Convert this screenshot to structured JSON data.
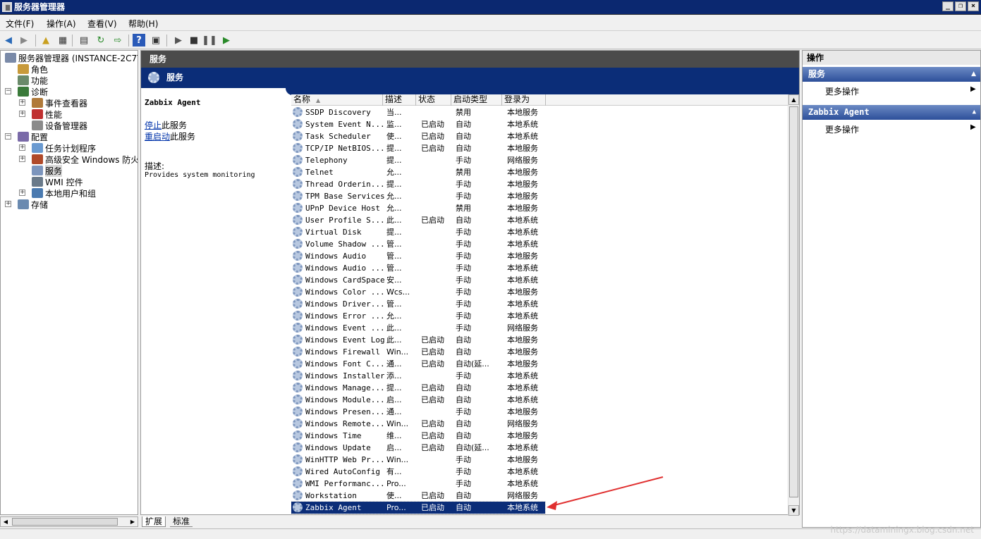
{
  "window": {
    "title": "服务器管理器",
    "buttons": [
      "_",
      "❐",
      "×"
    ]
  },
  "menu": [
    "文件(F)",
    "操作(A)",
    "查看(V)",
    "帮助(H)"
  ],
  "toolbar": [
    "back-icon",
    "forward-icon",
    "up-folder-icon",
    "show-hide-tree-icon",
    "properties-icon",
    "refresh-icon",
    "export-icon",
    "help-icon",
    "view-icon",
    "play-icon",
    "stop-icon",
    "pause-icon",
    "resume-icon"
  ],
  "tree": [
    {
      "label": "服务器管理器 (INSTANCE-2C7T7",
      "level": 0,
      "icon": "server-icon",
      "exp": ""
    },
    {
      "label": "角色",
      "level": 1,
      "icon": "roles-icon",
      "exp": ""
    },
    {
      "label": "功能",
      "level": 1,
      "icon": "features-icon",
      "exp": ""
    },
    {
      "label": "诊断",
      "level": 1,
      "icon": "diagnostics-icon",
      "exp": "-"
    },
    {
      "label": "事件查看器",
      "level": 2,
      "icon": "event-viewer-icon",
      "exp": "+"
    },
    {
      "label": "性能",
      "level": 2,
      "icon": "performance-icon",
      "exp": "+"
    },
    {
      "label": "设备管理器",
      "level": 2,
      "icon": "device-manager-icon",
      "exp": ""
    },
    {
      "label": "配置",
      "level": 1,
      "icon": "configuration-icon",
      "exp": "-"
    },
    {
      "label": "任务计划程序",
      "level": 2,
      "icon": "task-scheduler-icon",
      "exp": "+"
    },
    {
      "label": "高级安全 Windows 防火墙",
      "level": 2,
      "icon": "firewall-icon",
      "exp": "+"
    },
    {
      "label": "服务",
      "level": 2,
      "icon": "services-icon",
      "exp": "",
      "selected": true
    },
    {
      "label": "WMI 控件",
      "level": 2,
      "icon": "wmi-icon",
      "exp": ""
    },
    {
      "label": "本地用户和组",
      "level": 2,
      "icon": "users-groups-icon",
      "exp": "+"
    },
    {
      "label": "存储",
      "level": 1,
      "icon": "storage-icon",
      "exp": "+"
    }
  ],
  "center": {
    "title": "服务",
    "subtitle": "服务",
    "selected_name": "Zabbix Agent",
    "stop_link": "停止",
    "stop_suffix": "此服务",
    "restart_link": "重启动",
    "restart_suffix": "此服务",
    "desc_label": "描述:",
    "desc_text": "Provides system monitoring"
  },
  "columns": [
    "名称",
    "描述",
    "状态",
    "启动类型",
    "登录为"
  ],
  "services": [
    {
      "name": "SSDP Discovery",
      "desc": "当...",
      "status": "",
      "startup": "禁用",
      "logon": "本地服务"
    },
    {
      "name": "System Event N...",
      "desc": "监...",
      "status": "已启动",
      "startup": "自动",
      "logon": "本地系统"
    },
    {
      "name": "Task Scheduler",
      "desc": "使...",
      "status": "已启动",
      "startup": "自动",
      "logon": "本地系统"
    },
    {
      "name": "TCP/IP NetBIOS...",
      "desc": "提...",
      "status": "已启动",
      "startup": "自动",
      "logon": "本地服务"
    },
    {
      "name": "Telephony",
      "desc": "提...",
      "status": "",
      "startup": "手动",
      "logon": "网络服务"
    },
    {
      "name": "Telnet",
      "desc": "允...",
      "status": "",
      "startup": "禁用",
      "logon": "本地服务"
    },
    {
      "name": "Thread Orderin...",
      "desc": "提...",
      "status": "",
      "startup": "手动",
      "logon": "本地服务"
    },
    {
      "name": "TPM Base Services",
      "desc": "允...",
      "status": "",
      "startup": "手动",
      "logon": "本地服务"
    },
    {
      "name": "UPnP Device Host",
      "desc": "允...",
      "status": "",
      "startup": "禁用",
      "logon": "本地服务"
    },
    {
      "name": "User Profile S...",
      "desc": "此...",
      "status": "已启动",
      "startup": "自动",
      "logon": "本地系统"
    },
    {
      "name": "Virtual Disk",
      "desc": "提...",
      "status": "",
      "startup": "手动",
      "logon": "本地系统"
    },
    {
      "name": "Volume Shadow ...",
      "desc": "管...",
      "status": "",
      "startup": "手动",
      "logon": "本地系统"
    },
    {
      "name": "Windows Audio",
      "desc": "管...",
      "status": "",
      "startup": "手动",
      "logon": "本地服务"
    },
    {
      "name": "Windows Audio ...",
      "desc": "管...",
      "status": "",
      "startup": "手动",
      "logon": "本地系统"
    },
    {
      "name": "Windows CardSpace",
      "desc": "安...",
      "status": "",
      "startup": "手动",
      "logon": "本地系统"
    },
    {
      "name": "Windows Color ...",
      "desc": "Wcs...",
      "status": "",
      "startup": "手动",
      "logon": "本地服务"
    },
    {
      "name": "Windows Driver...",
      "desc": "管...",
      "status": "",
      "startup": "手动",
      "logon": "本地系统"
    },
    {
      "name": "Windows Error ...",
      "desc": "允...",
      "status": "",
      "startup": "手动",
      "logon": "本地系统"
    },
    {
      "name": "Windows Event ...",
      "desc": "此...",
      "status": "",
      "startup": "手动",
      "logon": "网络服务"
    },
    {
      "name": "Windows Event Log",
      "desc": "此...",
      "status": "已启动",
      "startup": "自动",
      "logon": "本地服务"
    },
    {
      "name": "Windows Firewall",
      "desc": "Win...",
      "status": "已启动",
      "startup": "自动",
      "logon": "本地服务"
    },
    {
      "name": "Windows Font C...",
      "desc": "通...",
      "status": "已启动",
      "startup": "自动(延...",
      "logon": "本地服务"
    },
    {
      "name": "Windows Installer",
      "desc": "添...",
      "status": "",
      "startup": "手动",
      "logon": "本地系统"
    },
    {
      "name": "Windows Manage...",
      "desc": "提...",
      "status": "已启动",
      "startup": "自动",
      "logon": "本地系统"
    },
    {
      "name": "Windows Module...",
      "desc": "启...",
      "status": "已启动",
      "startup": "自动",
      "logon": "本地系统"
    },
    {
      "name": "Windows Presen...",
      "desc": "通...",
      "status": "",
      "startup": "手动",
      "logon": "本地服务"
    },
    {
      "name": "Windows Remote...",
      "desc": "Win...",
      "status": "已启动",
      "startup": "自动",
      "logon": "网络服务"
    },
    {
      "name": "Windows Time",
      "desc": "维...",
      "status": "已启动",
      "startup": "自动",
      "logon": "本地服务"
    },
    {
      "name": "Windows Update",
      "desc": "启...",
      "status": "已启动",
      "startup": "自动(延...",
      "logon": "本地系统"
    },
    {
      "name": "WinHTTP Web Pr...",
      "desc": "Win...",
      "status": "",
      "startup": "手动",
      "logon": "本地服务"
    },
    {
      "name": "Wired AutoConfig",
      "desc": "有...",
      "status": "",
      "startup": "手动",
      "logon": "本地系统"
    },
    {
      "name": "WMI Performanc...",
      "desc": "Pro...",
      "status": "",
      "startup": "手动",
      "logon": "本地系统"
    },
    {
      "name": "Workstation",
      "desc": "使...",
      "status": "已启动",
      "startup": "自动",
      "logon": "网络服务"
    },
    {
      "name": "Zabbix Agent",
      "desc": "Pro...",
      "status": "已启动",
      "startup": "自动",
      "logon": "本地系统",
      "selected": true
    }
  ],
  "tabs": [
    "扩展",
    "标准"
  ],
  "actions": {
    "title": "操作",
    "sections": [
      {
        "title": "服务",
        "item": "更多操作"
      },
      {
        "title": "Zabbix Agent",
        "item": "更多操作"
      }
    ]
  },
  "watermark": "https://dataminingx.blog.csdn.net",
  "colors": {
    "accent": "#0b2d78",
    "titlebar": "#0b2870",
    "arrow": "#e03030"
  }
}
